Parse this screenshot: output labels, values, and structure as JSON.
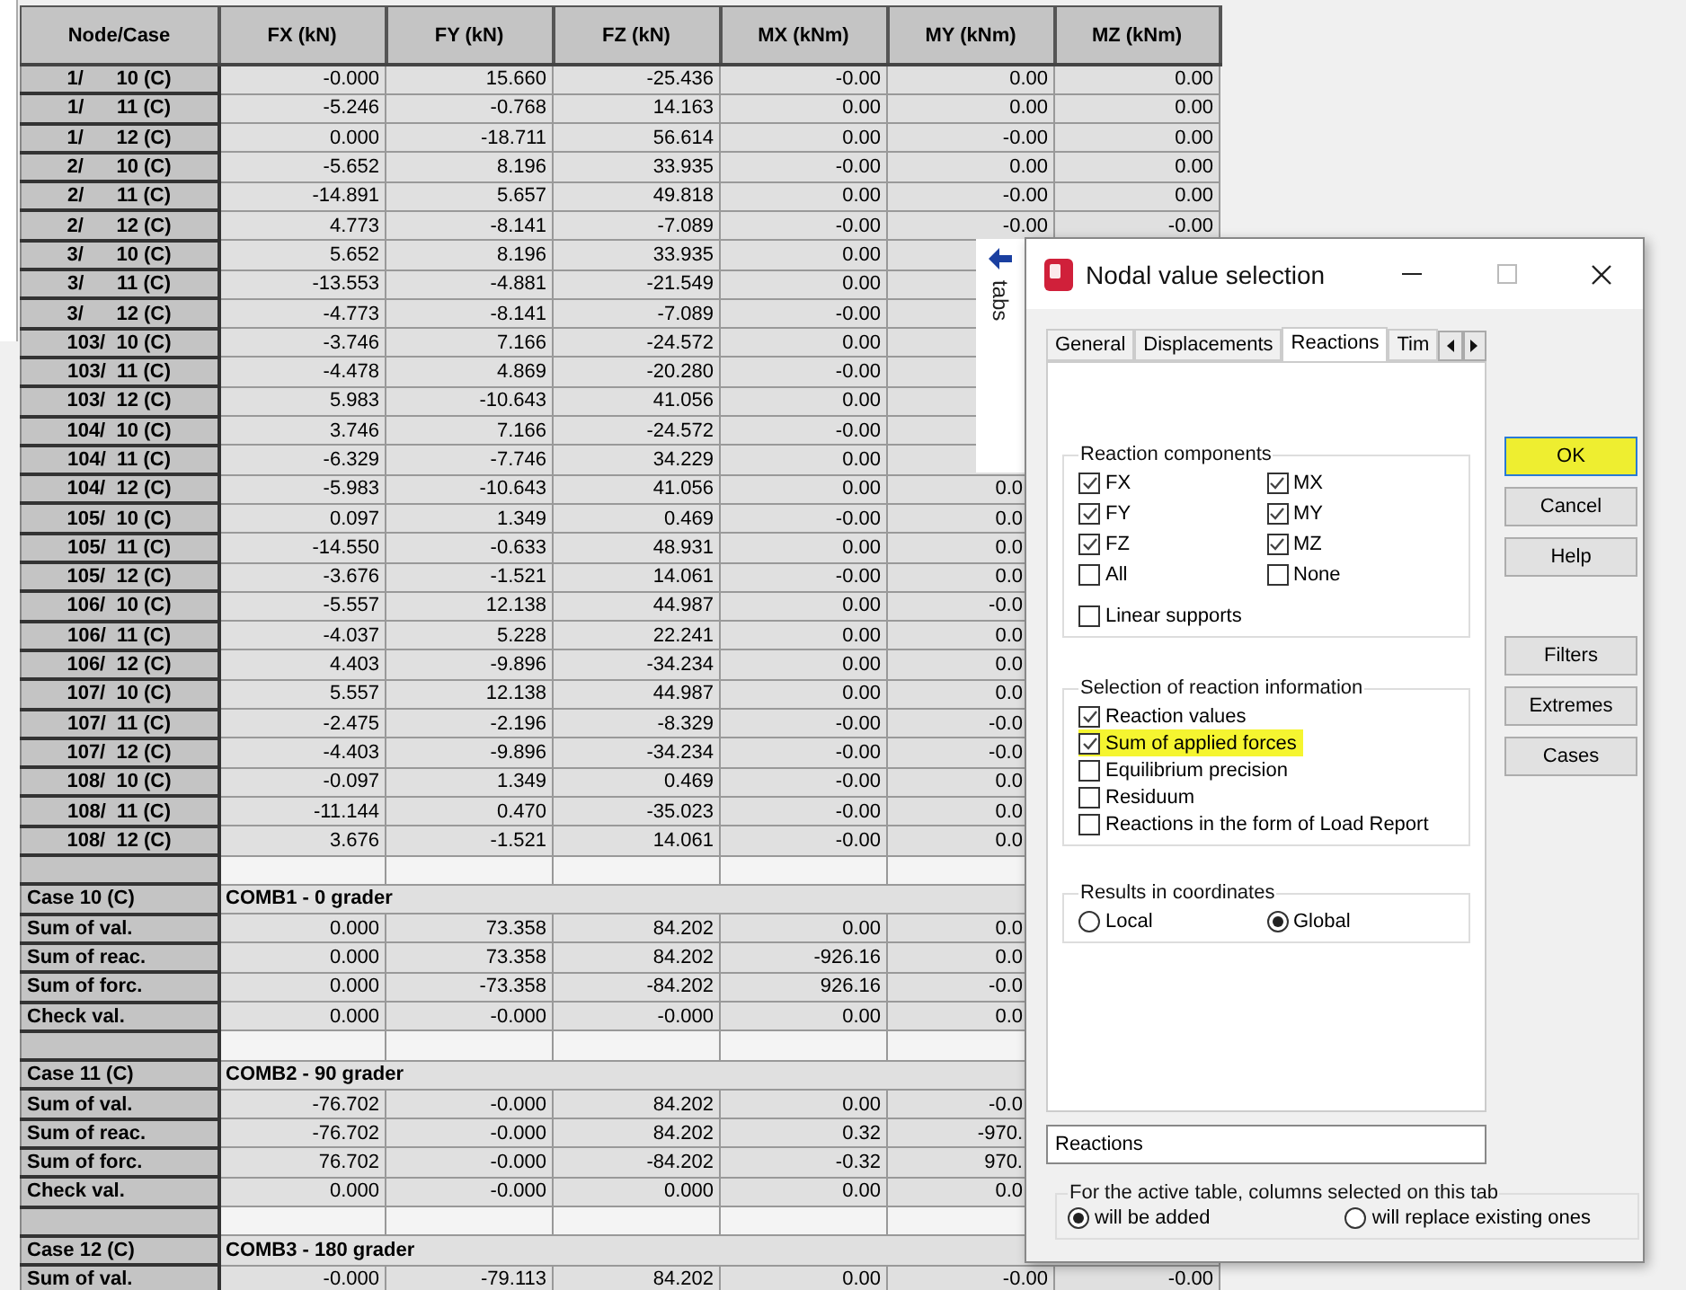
{
  "table": {
    "columns": [
      "Node/Case",
      "FX (kN)",
      "FY (kN)",
      "FZ (kN)",
      "MX (kNm)",
      "MY (kNm)",
      "MZ (kNm)"
    ],
    "rows": [
      {
        "kind": "data",
        "label": "1/      10 (C)",
        "cells": [
          "-0.000",
          "15.660",
          "-25.436",
          "-0.00",
          "0.00",
          "0.00"
        ]
      },
      {
        "kind": "data",
        "label": "1/      11 (C)",
        "cells": [
          "-5.246",
          "-0.768",
          "14.163",
          "0.00",
          "0.00",
          "0.00"
        ]
      },
      {
        "kind": "data",
        "label": "1/      12 (C)",
        "cells": [
          "0.000",
          "-18.711",
          "56.614",
          "0.00",
          "-0.00",
          "0.00"
        ]
      },
      {
        "kind": "data",
        "label": "2/      10 (C)",
        "cells": [
          "-5.652",
          "8.196",
          "33.935",
          "-0.00",
          "0.00",
          "0.00"
        ]
      },
      {
        "kind": "data",
        "label": "2/      11 (C)",
        "cells": [
          "-14.891",
          "5.657",
          "49.818",
          "0.00",
          "-0.00",
          "0.00"
        ]
      },
      {
        "kind": "data",
        "label": "2/      12 (C)",
        "cells": [
          "4.773",
          "-8.141",
          "-7.089",
          "-0.00",
          "-0.00",
          "-0.00"
        ]
      },
      {
        "kind": "data",
        "label": "3/      10 (C)",
        "cells": [
          "5.652",
          "8.196",
          "33.935",
          "0.00",
          null,
          null
        ]
      },
      {
        "kind": "data",
        "label": "3/      11 (C)",
        "cells": [
          "-13.553",
          "-4.881",
          "-21.549",
          "0.00",
          null,
          null
        ]
      },
      {
        "kind": "data",
        "label": "3/      12 (C)",
        "cells": [
          "-4.773",
          "-8.141",
          "-7.089",
          "-0.00",
          null,
          null
        ]
      },
      {
        "kind": "data",
        "label": "103/  10 (C)",
        "cells": [
          "-3.746",
          "7.166",
          "-24.572",
          "0.00",
          null,
          null
        ]
      },
      {
        "kind": "data",
        "label": "103/  11 (C)",
        "cells": [
          "-4.478",
          "4.869",
          "-20.280",
          "-0.00",
          null,
          null
        ]
      },
      {
        "kind": "data",
        "label": "103/  12 (C)",
        "cells": [
          "5.983",
          "-10.643",
          "41.056",
          "0.00",
          null,
          null
        ]
      },
      {
        "kind": "data",
        "label": "104/  10 (C)",
        "cells": [
          "3.746",
          "7.166",
          "-24.572",
          "-0.00",
          null,
          null
        ]
      },
      {
        "kind": "data",
        "label": "104/  11 (C)",
        "cells": [
          "-6.329",
          "-7.746",
          "34.229",
          "0.00",
          null,
          null
        ]
      },
      {
        "kind": "data",
        "label": "104/  12 (C)",
        "cells": [
          "-5.983",
          "-10.643",
          "41.056",
          "0.00",
          "0.0",
          null
        ]
      },
      {
        "kind": "data",
        "label": "105/  10 (C)",
        "cells": [
          "0.097",
          "1.349",
          "0.469",
          "-0.00",
          "0.0",
          null
        ]
      },
      {
        "kind": "data",
        "label": "105/  11 (C)",
        "cells": [
          "-14.550",
          "-0.633",
          "48.931",
          "0.00",
          "0.0",
          null
        ]
      },
      {
        "kind": "data",
        "label": "105/  12 (C)",
        "cells": [
          "-3.676",
          "-1.521",
          "14.061",
          "-0.00",
          "0.0",
          null
        ]
      },
      {
        "kind": "data",
        "label": "106/  10 (C)",
        "cells": [
          "-5.557",
          "12.138",
          "44.987",
          "0.00",
          "-0.0",
          null
        ]
      },
      {
        "kind": "data",
        "label": "106/  11 (C)",
        "cells": [
          "-4.037",
          "5.228",
          "22.241",
          "0.00",
          "0.0",
          null
        ]
      },
      {
        "kind": "data",
        "label": "106/  12 (C)",
        "cells": [
          "4.403",
          "-9.896",
          "-34.234",
          "0.00",
          "0.0",
          null
        ]
      },
      {
        "kind": "data",
        "label": "107/  10 (C)",
        "cells": [
          "5.557",
          "12.138",
          "44.987",
          "0.00",
          "0.0",
          null
        ]
      },
      {
        "kind": "data",
        "label": "107/  11 (C)",
        "cells": [
          "-2.475",
          "-2.196",
          "-8.329",
          "-0.00",
          "-0.0",
          null
        ]
      },
      {
        "kind": "data",
        "label": "107/  12 (C)",
        "cells": [
          "-4.403",
          "-9.896",
          "-34.234",
          "-0.00",
          "-0.0",
          null
        ]
      },
      {
        "kind": "data",
        "label": "108/  10 (C)",
        "cells": [
          "-0.097",
          "1.349",
          "0.469",
          "-0.00",
          "0.0",
          null
        ]
      },
      {
        "kind": "data",
        "label": "108/  11 (C)",
        "cells": [
          "-11.144",
          "0.470",
          "-35.023",
          "-0.00",
          "0.0",
          null
        ]
      },
      {
        "kind": "data",
        "label": "108/  12 (C)",
        "cells": [
          "3.676",
          "-1.521",
          "14.061",
          "-0.00",
          "0.0",
          null
        ]
      },
      {
        "kind": "blank"
      },
      {
        "kind": "case",
        "label": "Case 10 (C)",
        "title": "COMB1 - 0 grader"
      },
      {
        "kind": "sum",
        "label": "Sum of val.",
        "cells": [
          "0.000",
          "73.358",
          "84.202",
          "0.00",
          "0.0",
          null
        ]
      },
      {
        "kind": "sum",
        "label": "Sum of reac.",
        "cells": [
          "0.000",
          "73.358",
          "84.202",
          "-926.16",
          "0.0",
          null
        ]
      },
      {
        "kind": "sum",
        "label": "Sum of forc.",
        "cells": [
          "0.000",
          "-73.358",
          "-84.202",
          "926.16",
          "-0.0",
          null
        ]
      },
      {
        "kind": "sum",
        "label": "Check val.",
        "cells": [
          "0.000",
          "-0.000",
          "-0.000",
          "0.00",
          "0.0",
          null
        ]
      },
      {
        "kind": "blank"
      },
      {
        "kind": "case",
        "label": "Case 11 (C)",
        "title": "COMB2 - 90 grader"
      },
      {
        "kind": "sum",
        "label": "Sum of val.",
        "cells": [
          "-76.702",
          "-0.000",
          "84.202",
          "0.00",
          "-0.0",
          null
        ]
      },
      {
        "kind": "sum",
        "label": "Sum of reac.",
        "cells": [
          "-76.702",
          "-0.000",
          "84.202",
          "0.32",
          "-970.",
          null
        ]
      },
      {
        "kind": "sum",
        "label": "Sum of forc.",
        "cells": [
          "76.702",
          "-0.000",
          "-84.202",
          "-0.32",
          "970.",
          null
        ]
      },
      {
        "kind": "sum",
        "label": "Check val.",
        "cells": [
          "0.000",
          "-0.000",
          "0.000",
          "0.00",
          "0.0",
          null
        ]
      },
      {
        "kind": "blank"
      },
      {
        "kind": "case",
        "label": "Case 12 (C)",
        "title": "COMB3 - 180 grader"
      },
      {
        "kind": "sum",
        "label": "Sum of val.",
        "cells": [
          "-0.000",
          "-79.113",
          "84.202",
          "0.00",
          "-0.00",
          "-0.00"
        ]
      }
    ]
  },
  "side_panel": {
    "label": "tabs"
  },
  "dialog": {
    "title": "Nodal value selection",
    "tabs": [
      {
        "label": "General",
        "selected": false
      },
      {
        "label": "Displacements",
        "selected": false
      },
      {
        "label": "Reactions",
        "selected": true
      },
      {
        "label": "Tim",
        "selected": false
      }
    ],
    "buttons": [
      {
        "label": "OK",
        "highlighted": true
      },
      {
        "label": "Cancel",
        "highlighted": false
      },
      {
        "label": "Help",
        "highlighted": false
      },
      {
        "label": "Filters",
        "highlighted": false
      },
      {
        "label": "Extremes",
        "highlighted": false
      },
      {
        "label": "Cases",
        "highlighted": false
      }
    ],
    "components": {
      "title": "Reaction components",
      "items": [
        {
          "label": "FX",
          "checked": true
        },
        {
          "label": "MX",
          "checked": true
        },
        {
          "label": "FY",
          "checked": true
        },
        {
          "label": "MY",
          "checked": true
        },
        {
          "label": "FZ",
          "checked": true
        },
        {
          "label": "MZ",
          "checked": true
        },
        {
          "label": "All",
          "checked": false
        },
        {
          "label": "None",
          "checked": false
        }
      ],
      "extra": {
        "label": "Linear supports",
        "checked": false
      }
    },
    "information": {
      "title": "Selection of reaction information",
      "items": [
        {
          "label": "Reaction values",
          "checked": true,
          "highlighted": false
        },
        {
          "label": "Sum of applied forces",
          "checked": true,
          "highlighted": true
        },
        {
          "label": "Equilibrium precision",
          "checked": false,
          "highlighted": false
        },
        {
          "label": "Residuum",
          "checked": false,
          "highlighted": false
        },
        {
          "label": "Reactions in the form of Load Report",
          "checked": false,
          "highlighted": false
        }
      ]
    },
    "coordinates": {
      "title": "Results in coordinates",
      "options": [
        {
          "label": "Local",
          "selected": false
        },
        {
          "label": "Global",
          "selected": true
        }
      ]
    },
    "name_field": {
      "value": "Reactions"
    },
    "mode": {
      "title": "For the active table, columns selected on this tab",
      "options": [
        {
          "label": "will be added",
          "selected": true
        },
        {
          "label": "will replace existing ones",
          "selected": false
        }
      ]
    }
  }
}
